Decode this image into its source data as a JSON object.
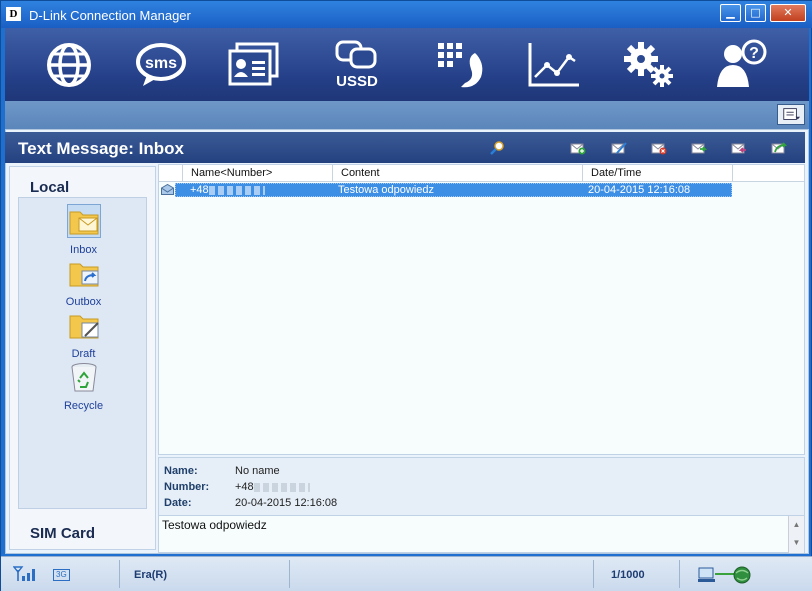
{
  "window": {
    "title": "D-Link Connection Manager",
    "logo_letter": "D",
    "minimize_glyph": "▁",
    "maximize_glyph": "□",
    "close_glyph": "✕"
  },
  "toolbar": {
    "buttons": [
      {
        "name": "internet-globe-icon"
      },
      {
        "name": "sms-icon",
        "label": "sms"
      },
      {
        "name": "contacts-card-icon"
      },
      {
        "name": "ussd-icon",
        "label": "USSD"
      },
      {
        "name": "dialpad-phone-icon"
      },
      {
        "name": "statistics-chart-icon"
      },
      {
        "name": "settings-gears-icon"
      },
      {
        "name": "help-user-icon"
      }
    ]
  },
  "section": {
    "title": "Text Message: Inbox"
  },
  "left": {
    "local_label": "Local",
    "folders": [
      {
        "label": "Inbox",
        "icon": "inbox-folder-icon"
      },
      {
        "label": "Outbox",
        "icon": "outbox-folder-icon"
      },
      {
        "label": "Draft",
        "icon": "draft-folder-icon"
      },
      {
        "label": "Recycle",
        "icon": "recycle-bin-icon"
      }
    ],
    "sim_label": "SIM Card"
  },
  "list": {
    "columns": [
      "Name<Number>",
      "Content",
      "Date/Time"
    ],
    "rows": [
      {
        "number": "+48",
        "content": "Testowa odpowiedz",
        "datetime": "20-04-2015 12:16:08"
      }
    ]
  },
  "detail": {
    "name_label": "Name:",
    "name_value": "No name",
    "number_label": "Number:",
    "number_value": "+48",
    "date_label": "Date:",
    "date_value": "20-04-2015 12:16:08",
    "message": "Testowa odpowiedz"
  },
  "status": {
    "network_type": "3G",
    "operator": "Era(R)",
    "sms_count": "1/1000"
  },
  "colors": {
    "accent": "#3d8fe6",
    "header": "#23417e"
  }
}
